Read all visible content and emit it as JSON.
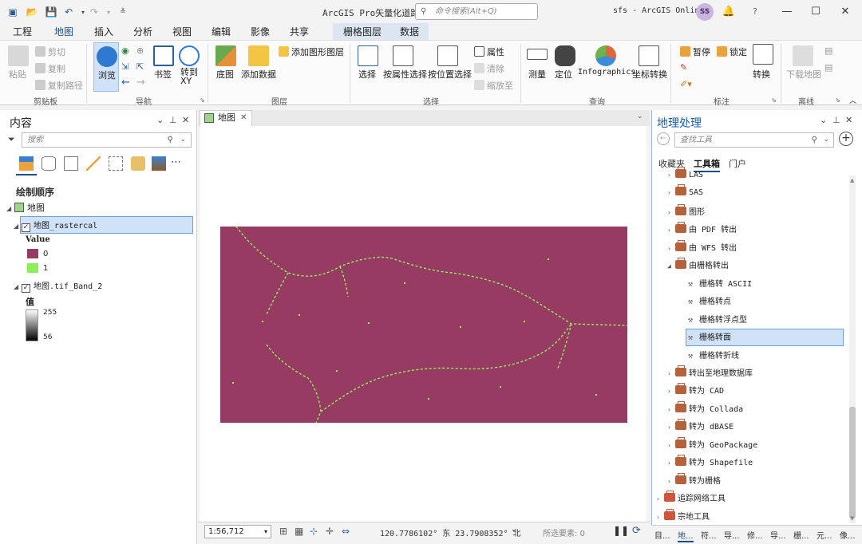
{
  "titlebar": {
    "title": "ArcGIS Pro矢量化道路",
    "search_placeholder": "命令搜索(Alt+Q)",
    "portal": "sfs - ArcGIS Online",
    "avatar": "SS",
    "help": "?"
  },
  "ribbon_tabs": [
    "工程",
    "地图",
    "插入",
    "分析",
    "视图",
    "编辑",
    "影像",
    "共享"
  ],
  "context_tabs": [
    "栅格图层",
    "数据"
  ],
  "ribbon": {
    "clipboard": {
      "label": "剪贴板",
      "paste": "粘贴",
      "cut": "剪切",
      "copy": "复制",
      "copy_path": "复制路径"
    },
    "navigate": {
      "label": "导航",
      "explore": "浏览",
      "bookmarks": "书签",
      "goto": "转到\nXY"
    },
    "layer": {
      "label": "图层",
      "basemap": "底图",
      "add_data": "添加数据",
      "add_graphics": "添加图形图层"
    },
    "selection": {
      "label": "选择",
      "select": "选择",
      "by_attr": "按属性选择",
      "by_loc": "按位置选择",
      "attributes": "属性",
      "clear": "清除",
      "zoom_to": "缩放至"
    },
    "inquiry": {
      "label": "查询",
      "measure": "测量",
      "locate": "定位",
      "infographics": "Infographics",
      "convert_coords": "坐标转换"
    },
    "labeling": {
      "label": "标注",
      "pause": "暂停",
      "lock": "锁定",
      "convert": "转换"
    },
    "offline": {
      "label": "离线",
      "download_map": "下载地图"
    }
  },
  "contents": {
    "title": "内容",
    "search_placeholder": "搜索",
    "drawing_order": "绘制顺序",
    "map": "地图",
    "layer1": "地图_rastercal",
    "legend_title": "Value",
    "legend": [
      {
        "label": "0",
        "color": "#973b63"
      },
      {
        "label": "1",
        "color": "#8cef5a"
      }
    ],
    "layer2": "地图.tif_Band_2",
    "value_label": "值",
    "ramp_high": "255",
    "ramp_low": "56"
  },
  "map": {
    "tab": "地图",
    "scale": "1:56,712",
    "coords": "120.7786102° 东 23.7908352° 北",
    "selected_features": "所选要素: 0",
    "raster_background": "#973b63",
    "road_color": "#8cef5a"
  },
  "geoprocessing": {
    "title": "地理处理",
    "search_placeholder": "查找工具",
    "tabs": [
      "收藏夹",
      "工具箱",
      "门户"
    ],
    "items": [
      {
        "label": "LAS",
        "type": "toolset",
        "level": 1
      },
      {
        "label": "SAS",
        "type": "toolset",
        "level": 1
      },
      {
        "label": "图形",
        "type": "toolset",
        "level": 1
      },
      {
        "label": "由 PDF 转出",
        "type": "toolset",
        "level": 1
      },
      {
        "label": "由 WFS 转出",
        "type": "toolset",
        "level": 1
      },
      {
        "label": "由栅格转出",
        "type": "toolset",
        "level": 1,
        "expanded": true
      },
      {
        "label": "栅格转 ASCII",
        "type": "tool",
        "level": 2
      },
      {
        "label": "栅格转点",
        "type": "tool",
        "level": 2
      },
      {
        "label": "栅格转浮点型",
        "type": "tool",
        "level": 2
      },
      {
        "label": "栅格转面",
        "type": "tool",
        "level": 2,
        "selected": true
      },
      {
        "label": "栅格转折线",
        "type": "tool",
        "level": 2
      },
      {
        "label": "转出至地理数据库",
        "type": "toolset",
        "level": 1
      },
      {
        "label": "转为 CAD",
        "type": "toolset",
        "level": 1
      },
      {
        "label": "转为 Collada",
        "type": "toolset",
        "level": 1
      },
      {
        "label": "转为 dBASE",
        "type": "toolset",
        "level": 1
      },
      {
        "label": "转为 GeoPackage",
        "type": "toolset",
        "level": 1
      },
      {
        "label": "转为 Shapefile",
        "type": "toolset",
        "level": 1
      },
      {
        "label": "转为栅格",
        "type": "toolset",
        "level": 1
      },
      {
        "label": "追踪网络工具",
        "type": "toolbox",
        "level": 0
      },
      {
        "label": "宗地工具",
        "type": "toolbox",
        "level": 0
      }
    ],
    "bottom_tabs": [
      "目...",
      "地...",
      "符...",
      "导...",
      "修...",
      "导...",
      "栅...",
      "元...",
      "像..."
    ]
  }
}
